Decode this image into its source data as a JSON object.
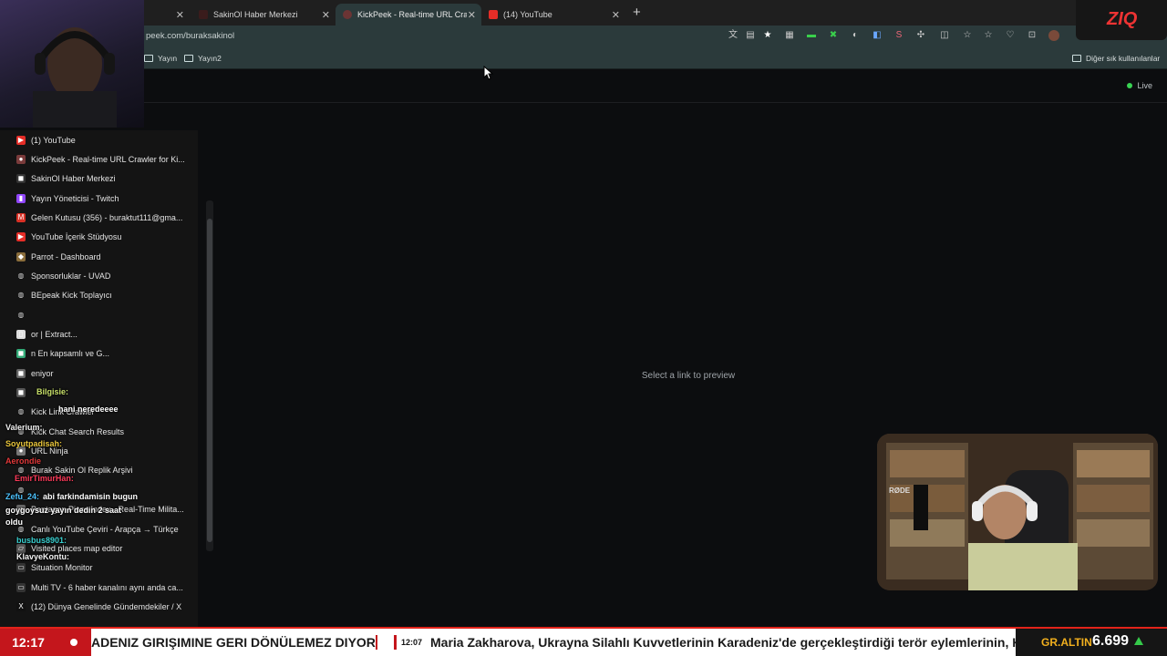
{
  "browser": {
    "tabs": [
      {
        "label": "SakinOl Haber Merkezi",
        "color": "#c0392b",
        "active": false
      },
      {
        "label": "KickPeek - Real-time URL Crawler f",
        "color": "#8e44ad",
        "active": true
      },
      {
        "label": "(14) YouTube",
        "color": "#e52d27",
        "active": false
      }
    ],
    "address": "peek.com/buraksakinol",
    "bookmarks": [
      "Yayın",
      "Yayın2"
    ],
    "other_bookmarks": "Diğer sık kullanılanlar"
  },
  "page": {
    "status": "Live",
    "empty_preview": "Select a link to preview"
  },
  "dropdown": {
    "items": [
      {
        "label": "(1) YouTube",
        "icon": "youtube-icon",
        "color": "#e52d27"
      },
      {
        "label": "KickPeek - Real-time URL Crawler for Ki...",
        "icon": "kickpeek-icon",
        "color": "#7a3b3b"
      },
      {
        "label": "SakinOl Haber Merkezi",
        "icon": "sakinol-icon",
        "color": "#333"
      },
      {
        "label": "Yayın Yöneticisi - Twitch",
        "icon": "twitch-icon",
        "color": "#9146ff"
      },
      {
        "label": "Gelen Kutusu (356) - buraktut111@gma...",
        "icon": "gmail-icon",
        "color": "#d93025"
      },
      {
        "label": "YouTube İçerik Stüdyosu",
        "icon": "youtube-studio-icon",
        "color": "#e52d27"
      },
      {
        "label": "Parrot - Dashboard",
        "icon": "parrot-icon",
        "color": "#8a6d3b"
      },
      {
        "label": "Sponsorluklar - UVAD",
        "icon": "globe-icon",
        "color": "transparent"
      },
      {
        "label": "BEpeak Kick  Toplayıcı",
        "icon": "globe-icon",
        "color": "transparent"
      },
      {
        "label": "",
        "icon": "globe-icon",
        "color": "transparent"
      },
      {
        "label": "or | Extract...",
        "icon": "doc-icon",
        "color": "#ddd"
      },
      {
        "label": "n En kapsamlı ve G...",
        "icon": "app-icon",
        "color": "#3a7"
      },
      {
        "label": "eniyor",
        "icon": "app-icon",
        "color": "#666"
      },
      {
        "label": "",
        "icon": "app-icon",
        "color": "#555"
      },
      {
        "label": "Kick Link Crawler",
        "icon": "globe-icon",
        "color": "transparent"
      },
      {
        "label": "Kick Chat Search Results",
        "icon": "globe-icon",
        "color": "transparent"
      },
      {
        "label": "URL Ninja",
        "icon": "ninja-icon",
        "color": "#777"
      },
      {
        "label": "Burak Sakin Ol Replik Arşivi",
        "icon": "globe-icon",
        "color": "transparent"
      },
      {
        "label": "",
        "icon": "globe-icon",
        "color": "transparent"
      },
      {
        "label": "Pentagon Pizza Index - Real-Time Milita...",
        "icon": "pizza-icon",
        "color": "#666"
      },
      {
        "label": "Canlı YouTube Çeviri - Arapça → Türkçe",
        "icon": "globe-icon",
        "color": "transparent"
      },
      {
        "label": "Visited places map editor",
        "icon": "map-icon",
        "color": "#555"
      },
      {
        "label": "Situation Monitor",
        "icon": "monitor-icon",
        "color": "#333"
      },
      {
        "label": "Multi TV - 6 haber kanalını aynı anda ca...",
        "icon": "tv-icon",
        "color": "#333"
      },
      {
        "label": "(12) Dünya Genelinde Gündemdekiler / X",
        "icon": "x-icon",
        "color": "#111"
      }
    ]
  },
  "chat": [
    {
      "user": "Bilgisie:",
      "msg": "",
      "color": "#c8e06a"
    },
    {
      "user": "",
      "msg": "hani neredeeee",
      "color": "#ffffff"
    },
    {
      "user": "Valerium:",
      "msg": "",
      "color": "#f0f0f0"
    },
    {
      "user": "Soyutpadisah:",
      "msg": "",
      "color": "#e9c63b"
    },
    {
      "user": "Aerondie",
      "msg": "",
      "color": "#e2393a"
    },
    {
      "user": "EmirTimurHan:",
      "msg": "",
      "color": "#ff3a5a"
    },
    {
      "user": "Zefu_24:",
      "msg": "abi farkindamisin bugun",
      "color": "#4cc3ff"
    },
    {
      "user": "",
      "msg": "goygoysuz yayın dedin 2 saat",
      "color": "#ffffff"
    },
    {
      "user": "",
      "msg": "oldu",
      "color": "#ffffff"
    },
    {
      "user": "busbus8901:",
      "msg": "",
      "color": "#3ad0d0"
    },
    {
      "user": "KlavyeKontu:",
      "msg": "",
      "color": "#f5f5f5"
    }
  ],
  "ticker": {
    "time": "12:17",
    "headline_a": "ADENIZ GIRIŞIMINE GERI DÖNÜLEMEZ DIYOR",
    "tag_time": "12:07",
    "headline_b": "Maria Zakharova, Ukrayna Silahlı Kuvvetlerinin Karadeniz'de gerçekleştirdiği terör eylemlerinin, Kie",
    "gold_label": "GR.ALTIN",
    "gold_value": "6.699"
  },
  "overlay": {
    "logo": "ZIQ",
    "mic_brand": "RØDE"
  }
}
